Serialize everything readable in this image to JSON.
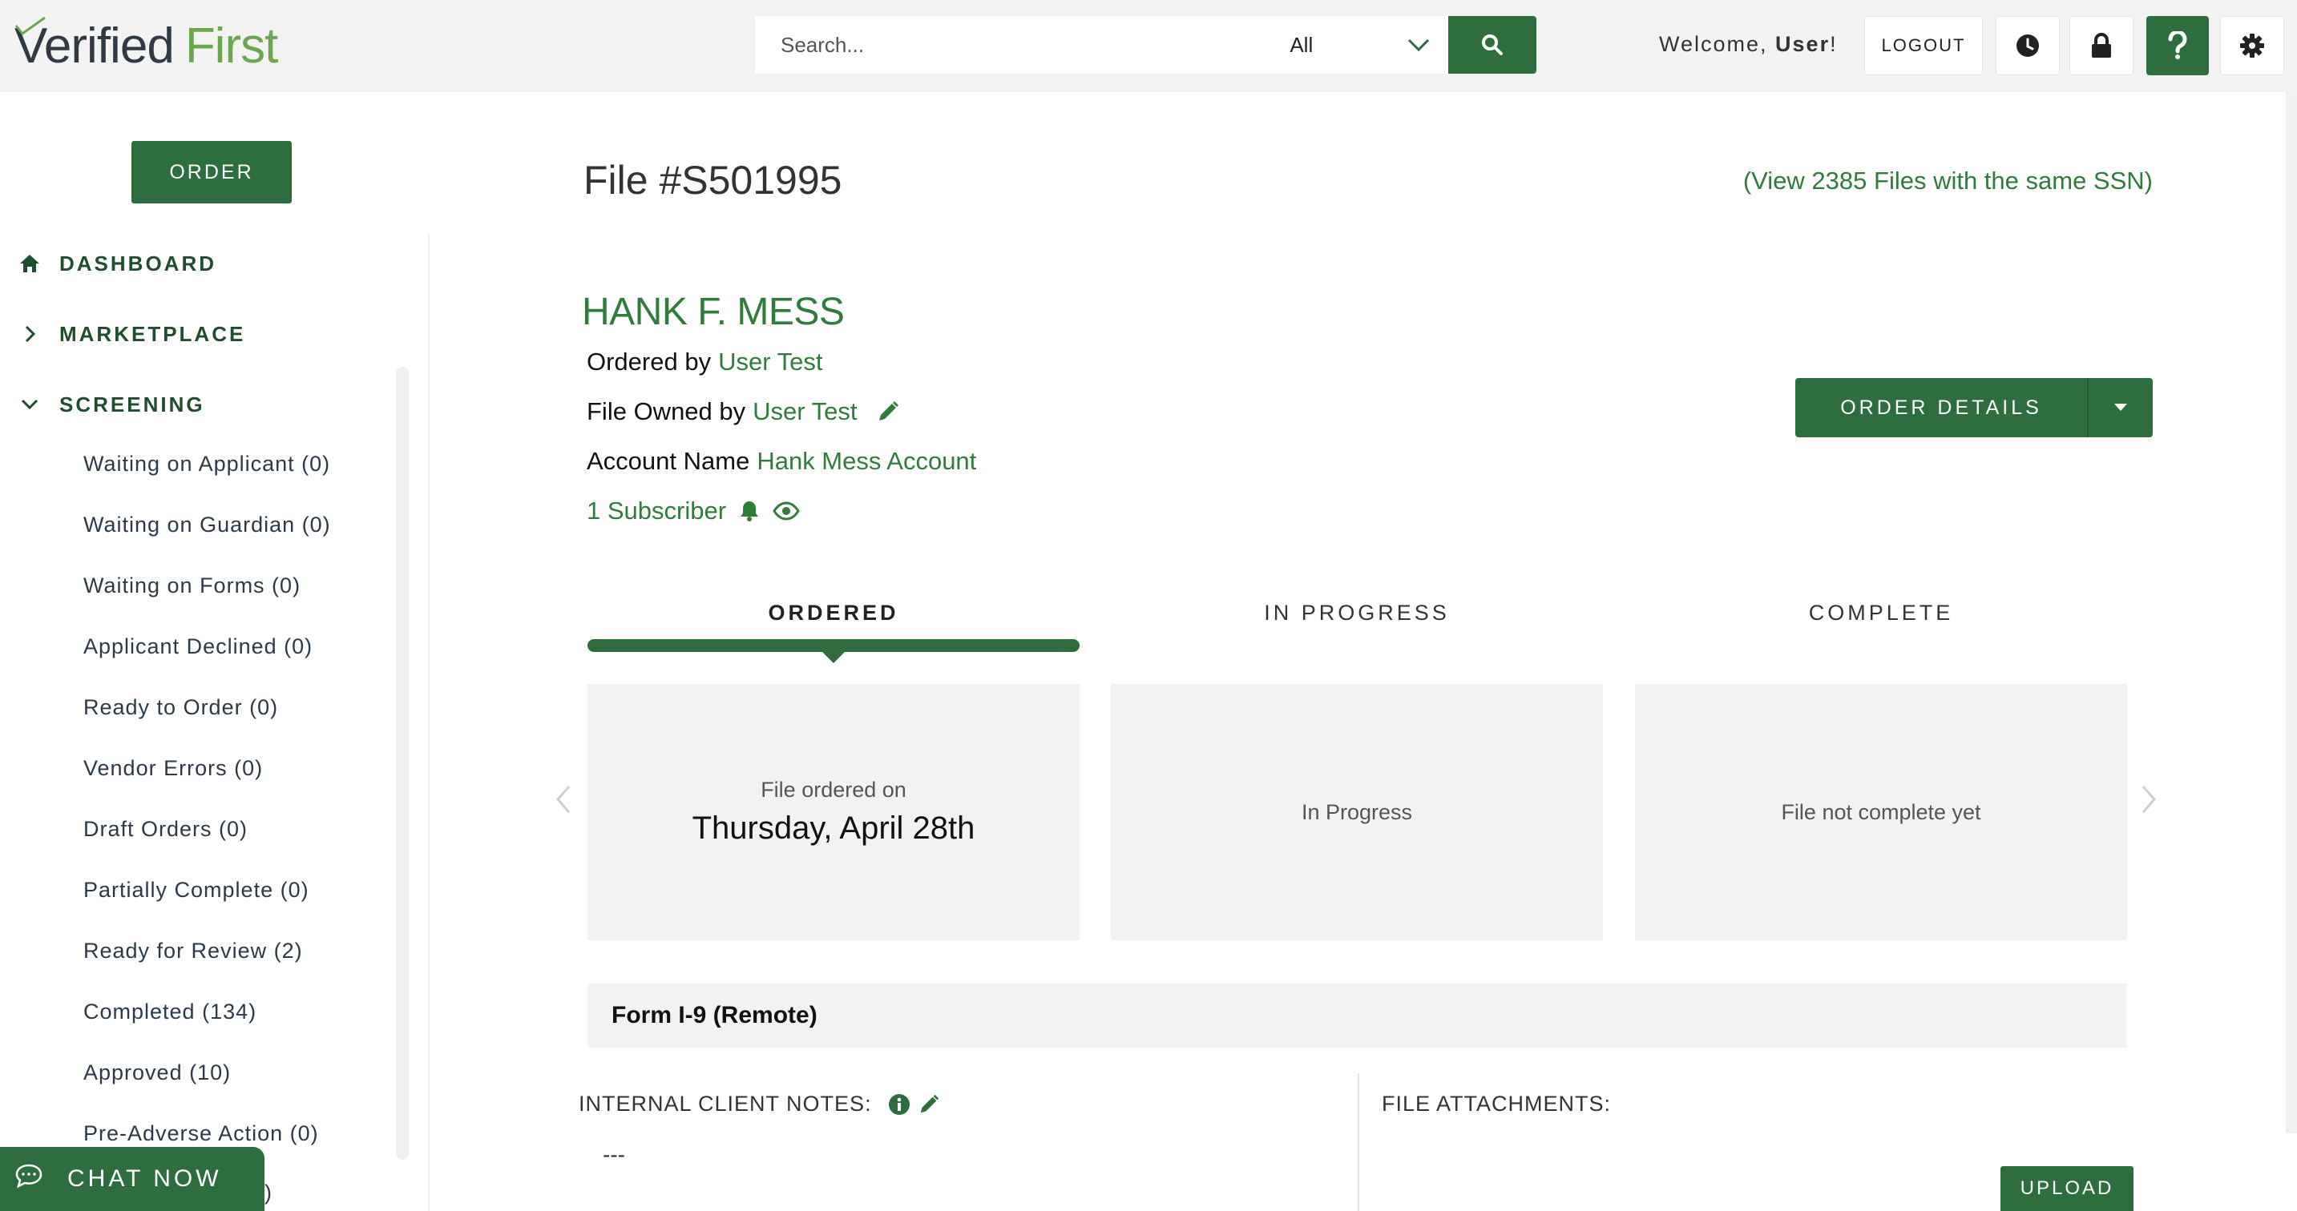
{
  "brand": {
    "logo_part1": "Verified",
    "logo_part2": "First"
  },
  "colors": {
    "primary": "#2e6e3e",
    "link_green": "#2e7d3a",
    "topbar_bg": "#f3f3f3",
    "card_bg": "#f2f2f2"
  },
  "search": {
    "placeholder": "Search...",
    "scope_value": "All"
  },
  "header": {
    "welcome_prefix": "Welcome, ",
    "welcome_user": "User",
    "welcome_suffix": "!",
    "logout_label": "LOGOUT",
    "icons": [
      "history-clock-icon",
      "lock-icon",
      "help-icon",
      "settings-gear-icon"
    ]
  },
  "sidebar": {
    "order_label": "ORDER",
    "dashboard_label": "DASHBOARD",
    "marketplace_label": "MARKETPLACE",
    "screening_label": "SCREENING",
    "screening_items": [
      "Waiting on Applicant (0)",
      "Waiting on Guardian (0)",
      "Waiting on Forms (0)",
      "Applicant Declined (0)",
      "Ready to Order (0)",
      "Vendor Errors (0)",
      "Draft Orders (0)",
      "Partially Complete (0)",
      "Ready for Review (2)",
      "Completed (134)",
      "Approved (10)",
      "Pre-Adverse Action (0)"
    ],
    "peek_text": ")"
  },
  "chat": {
    "label": "CHAT NOW"
  },
  "file": {
    "title": "File #S501995",
    "same_ssn_link": "(View 2385 Files with the same SSN)",
    "person_name": "HANK F. MESS",
    "ordered_by_label": "Ordered by",
    "ordered_by_value": "User Test",
    "owned_by_label": "File Owned by",
    "owned_by_value": "User Test",
    "account_label": "Account Name",
    "account_value": "Hank Mess Account",
    "subscriber_text": "1 Subscriber",
    "order_details_label": "ORDER DETAILS"
  },
  "status_steps": {
    "labels": [
      "ORDERED",
      "IN PROGRESS",
      "COMPLETE"
    ],
    "active_step": "ORDERED",
    "ordered_small": "File ordered on",
    "ordered_date": "Thursday, April 28th",
    "in_progress_text": "In Progress",
    "complete_text": "File not complete yet"
  },
  "form_section": {
    "title": "Form I-9 (Remote)"
  },
  "notes": {
    "internal_label": "INTERNAL CLIENT NOTES:",
    "internal_value": "---",
    "attachments_label": "FILE ATTACHMENTS:",
    "upload_label": "UPLOAD"
  }
}
